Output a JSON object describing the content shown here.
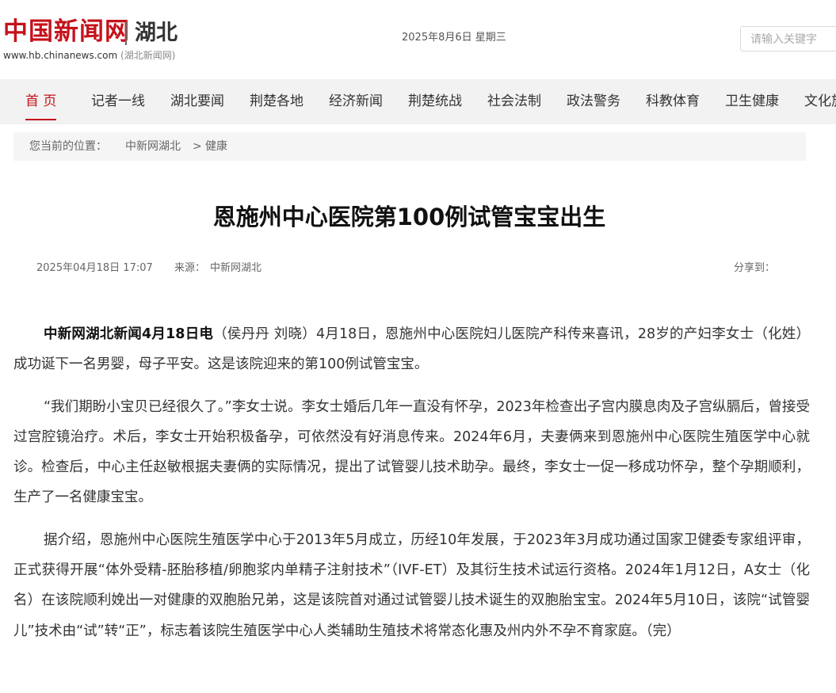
{
  "header": {
    "logo_text": "中国新闻网",
    "region": "湖北",
    "url": "www.hb.chinanews.com",
    "url_sub": "(湖北新闻网)",
    "date": "2025年8月6日 星期三",
    "search_placeholder": "请输入关键字"
  },
  "nav": {
    "items": [
      "首 页",
      "记者一线",
      "湖北要闻",
      "荆楚各地",
      "经济新闻",
      "荆楚统战",
      "社会法制",
      "政法警务",
      "科教体育",
      "卫生健康",
      "文化旅"
    ],
    "active_index": 0
  },
  "breadcrumb": {
    "label": "您当前的位置：",
    "home": "中新网湖北",
    "separator": ">",
    "current": "健康"
  },
  "article": {
    "title": "恩施州中心医院第100例试管宝宝出生",
    "datetime": "2025年04月18日 17:07",
    "source_label": "来源：",
    "source": "中新网湖北",
    "share_label": "分享到：",
    "lead_bold": "中新网湖北新闻4月18日电",
    "lead_rest": "（侯丹丹 刘晓）4月18日，恩施州中心医院妇儿医院产科传来喜讯，28岁的产妇李女士（化姓）成功诞下一名男婴，母子平安。这是该院迎来的第100例试管宝宝。",
    "para2": "“我们期盼小宝贝已经很久了。”李女士说。李女士婚后几年一直没有怀孕，2023年检查出子宫内膜息肉及子宫纵膈后，曾接受过宫腔镜治疗。术后，李女士开始积极备孕，可依然没有好消息传来。2024年6月，夫妻俩来到恩施州中心医院生殖医学中心就诊。检查后，中心主任赵敏根据夫妻俩的实际情况，提出了试管婴儿技术助孕。最终，李女士一促一移成功怀孕，整个孕期顺利，生产了一名健康宝宝。",
    "para3": "据介绍，恩施州中心医院生殖医学中心于2013年5月成立，历经10年发展，于2023年3月成功通过国家卫健委专家组评审，正式获得开展“体外受精-胚胎移植/卵胞浆内单精子注射技术”（IVF-ET）及其衍生技术试运行资格。2024年1月12日，A女士（化名）在该院顺利娩出一对健康的双胞胎兄弟，这是该院首对通过试管婴儿技术诞生的双胞胎宝宝。2024年5月10日，该院“试管婴儿”技术由“试”转“正”，标志着该院生殖医学中心人类辅助生殖技术将常态化惠及州内外不孕不育家庭。（完）"
  },
  "colors": {
    "brand_red": "#c4121b",
    "nav_bg": "#f2f2f2"
  }
}
